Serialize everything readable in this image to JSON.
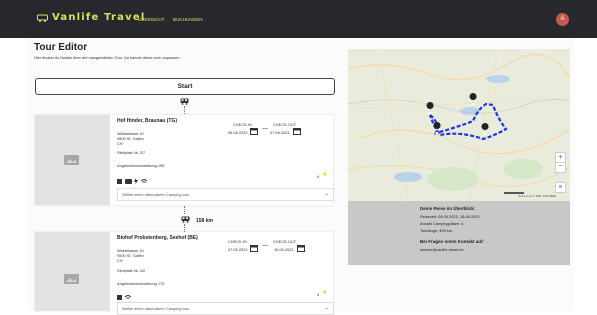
{
  "app": {
    "brand": "Vanlife Travel",
    "nav": [
      "ÜBERSICHT",
      "BUCHUNGEN"
    ],
    "avatar_initial": "A",
    "colors": {
      "topbar": "#27282d",
      "brand": "#d9e35a",
      "avatar": "#c45a4d"
    }
  },
  "page": {
    "title": "Tour Editor",
    "subtitle": "Hier findest du Details über den ausgewählten Tour. Du kannst diese noch anpassen.",
    "start_label": "Start"
  },
  "stops": [
    {
      "name": "Hof Hinder, Braunau (TG)",
      "address": [
        "Waldstrasse 10",
        "9500 St. Gallen",
        "CH"
      ],
      "spot": "Stellplatz Nr. i37",
      "description": "Angebotsbeschreibung 195",
      "checkin_label": "CHECK-IN",
      "checkin_date": "06.06.2023",
      "checkout_label": "CHECK-OUT",
      "checkout_date": "07.06.2023",
      "rating": "4",
      "alt_select": "Wähle einen alternativen Camping aus",
      "amenities": [
        "shower-icon",
        "van-icon",
        "electric-icon",
        "wifi-icon"
      ]
    },
    {
      "name": "Biohof Probstenberg, Seehof (BE)",
      "address": [
        "Waldstrasse 10",
        "9500 St. Gallen",
        "CH"
      ],
      "spot": "Stellplatz Nr. i42",
      "description": "Angebotsbeschreibung 175",
      "checkin_label": "CHECK-IN",
      "checkin_date": "07.06.2023",
      "checkout_label": "CHECK-OUT",
      "checkout_date": "15.06.2023",
      "rating": "4",
      "alt_select": "Wähle einen alternativen Camping aus",
      "amenities": [
        "shower-icon",
        "wifi-icon"
      ]
    }
  ],
  "distance": "158 km",
  "summary": {
    "heading": "Deine Reise im Überblick:",
    "reisezeit": "Reisezeit: 06.06.2023 -15.06.2023",
    "count": "Anzahl Campingplätze: 4",
    "length": "Tourlänge: 499 km",
    "contact_heading": "Bei Fragen nimm Kontakt auf:",
    "email": "service@vanlife-travel.ch"
  },
  "map": {
    "attribution": "Terms of use   © 1987–2023 HERE",
    "route_color": "#2233dd"
  }
}
